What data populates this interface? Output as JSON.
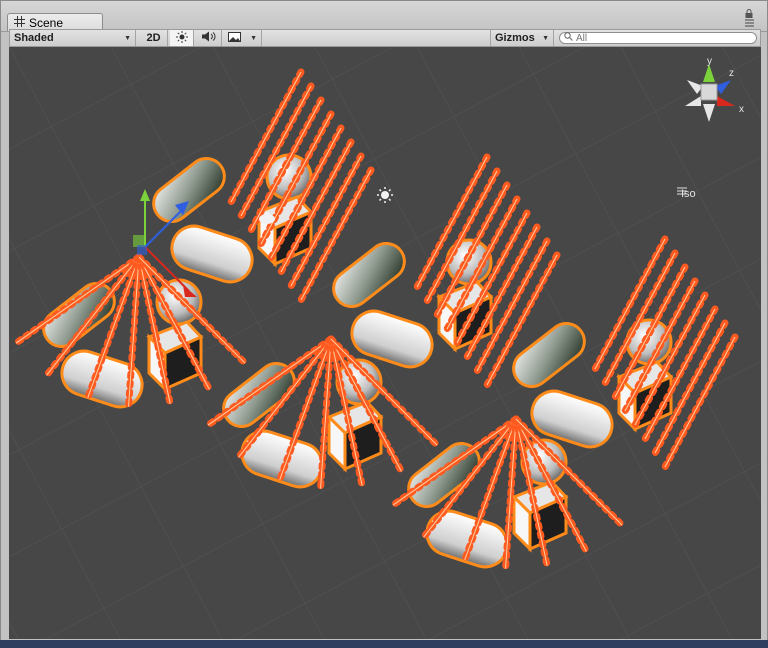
{
  "window": {
    "tab_title": "Scene",
    "icons": {
      "tab": "grid-icon",
      "menu": "menu-icon",
      "lock": "lock-icon"
    }
  },
  "toolbar": {
    "shading_mode": "Shaded",
    "mode_2d": "2D",
    "lighting_icon": "sun-icon",
    "audio_icon": "speaker-icon",
    "effects_icon": "image-icon",
    "gizmos_label": "Gizmos",
    "search_placeholder": "All"
  },
  "viewport": {
    "background_color": "#474747",
    "selection_color": "#ff8c1a",
    "projection_label": "Iso",
    "orientation_gizmo": {
      "axes": [
        "y",
        "z",
        "x"
      ],
      "colors": {
        "x": "#d9281e",
        "y": "#7bd23a",
        "z": "#2f5fe0"
      }
    }
  }
}
